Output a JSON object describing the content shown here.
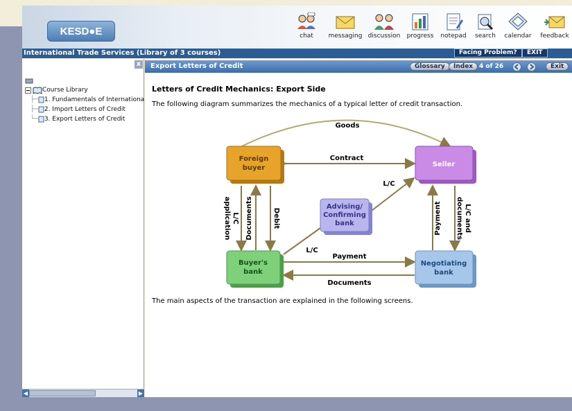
{
  "header": {
    "logo": "KESD●E",
    "toolbar": [
      {
        "label": "chat",
        "icon": "chat-icon"
      },
      {
        "label": "messaging",
        "icon": "messaging-icon"
      },
      {
        "label": "discussion",
        "icon": "discussion-icon"
      },
      {
        "label": "progress",
        "icon": "progress-icon"
      },
      {
        "label": "notepad",
        "icon": "notepad-icon"
      },
      {
        "label": "search",
        "icon": "search-icon"
      },
      {
        "label": "calendar",
        "icon": "calendar-icon"
      },
      {
        "label": "feedback",
        "icon": "feedback-icon"
      }
    ]
  },
  "titlebar": {
    "title": "International Trade Services (Library of 3 courses)",
    "facing_problem": "Facing Problem?",
    "exit": "EXIT"
  },
  "sidebar": {
    "close": "x",
    "root": "Course Library",
    "items": [
      {
        "label": "1. Fundamentals of Internationa"
      },
      {
        "label": "2. Import Letters of Credit"
      },
      {
        "label": "3. Export Letters of Credit"
      }
    ]
  },
  "content": {
    "bar_title": "Export Letters of Credit",
    "glossary": "Glossary",
    "index": "Index",
    "page": "4 of 26",
    "exit": "Exit",
    "heading": "Letters of Credit Mechanics: Export Side",
    "intro": "The following diagram summarizes the mechanics of a typical letter of credit transaction.",
    "outro": "The main aspects of the transaction are explained in the following screens."
  },
  "diagram": {
    "nodes": {
      "foreign_buyer": "Foreign buyer",
      "seller": "Seller",
      "advising": "Advising/ Confirming bank",
      "buyers_bank": "Buyer's bank",
      "negotiating": "Negotiating bank"
    },
    "labels": {
      "goods": "Goods",
      "contract": "Contract",
      "lc_top": "L/C",
      "lc_app": "L/C application",
      "documents_v": "Documents",
      "debit": "Debit",
      "lc_bottom": "L/C",
      "payment_h": "Payment",
      "documents_h": "Documents",
      "payment_v": "Payment",
      "lc_docs": "L/C and documents"
    },
    "colors": {
      "foreign_buyer": "#e8a32a",
      "seller": "#c98be6",
      "advising": "#b9b6ef",
      "buyers_bank": "#7fd07a",
      "negotiating": "#a6c6ea",
      "arrow": "#8a7a45"
    }
  }
}
